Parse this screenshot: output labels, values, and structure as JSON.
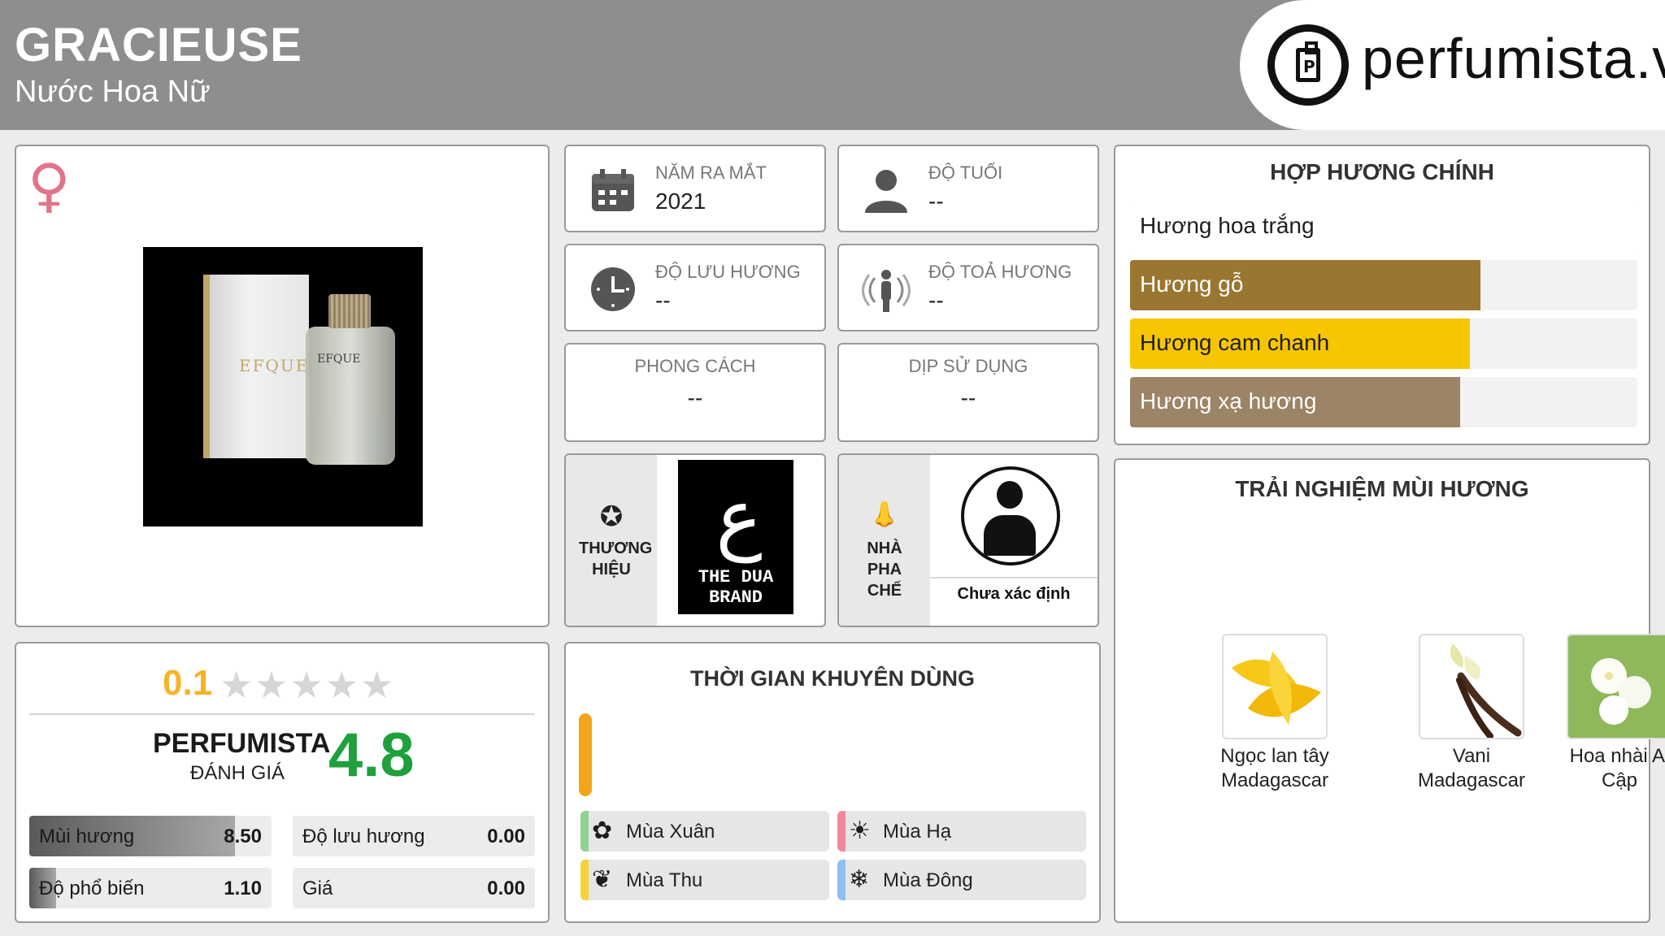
{
  "header": {
    "title": "GRACIEUSE",
    "subtitle": "Nước Hoa Nữ",
    "site": "perfumista.vn"
  },
  "gender_icon": "female-icon",
  "stats": {
    "year": {
      "label": "NĂM RA MẮT",
      "value": "2021"
    },
    "age": {
      "label": "ĐỘ TUỔI",
      "value": "--"
    },
    "longevity": {
      "label": "ĐỘ LƯU HƯƠNG",
      "value": "--"
    },
    "sillage": {
      "label": "ĐỘ TOẢ HƯƠNG",
      "value": "--"
    },
    "style": {
      "label": "PHONG CÁCH",
      "value": "--"
    },
    "occasion": {
      "label": "DỊP SỬ DỤNG",
      "value": "--"
    }
  },
  "brand": {
    "label": "THƯƠNG HIỆU",
    "logo_text": "THE DUA BRAND"
  },
  "perfumer": {
    "label": "NHÀ PHA CHẾ",
    "name": "Chưa xác định"
  },
  "accords": {
    "title": "HỢP HƯƠNG CHÍNH",
    "items": [
      {
        "name": "Hương hoa trắng",
        "fraction": 1.0,
        "color": "#ffffff",
        "text_color": "#1e1e1e"
      },
      {
        "name": "Hương gỗ",
        "fraction": 0.69,
        "color": "#9a7630",
        "text_color": "#ffffff"
      },
      {
        "name": "Hương cam chanh",
        "fraction": 0.67,
        "color": "#f7c600",
        "text_color": "#1e1e1e"
      },
      {
        "name": "Hương xạ hương",
        "fraction": 0.65,
        "color": "#9c8466",
        "text_color": "#ffffff"
      }
    ]
  },
  "notes": {
    "title": "TRẢI NGHIỆM MÙI HƯƠNG",
    "items": [
      {
        "name_line1": "Ngọc lan tây",
        "name_line2": "Madagascar"
      },
      {
        "name_line1": "Vani",
        "name_line2": "Madagascar"
      },
      {
        "name_line1": "Hoa nhài Ai",
        "name_line2": "Cập"
      }
    ]
  },
  "rating": {
    "user_score": "0.1",
    "stars_total": 5,
    "perfumista_label": "PERFUMISTA",
    "perfumista_sub": "ĐÁNH GIÁ",
    "perfumista_score": "4.8",
    "metrics": [
      {
        "label": "Mùi hương",
        "value": "8.50",
        "fraction": 0.85
      },
      {
        "label": "Độ lưu hương",
        "value": "0.00",
        "fraction": 0
      },
      {
        "label": "Độ phổ biến",
        "value": "1.10",
        "fraction": 0.11
      },
      {
        "label": "Giá",
        "value": "0.00",
        "fraction": 0
      }
    ]
  },
  "timing": {
    "title": "THỜI GIAN KHUYÊN DÙNG",
    "seasons": [
      {
        "name": "Mùa Xuân",
        "icon": "flower-icon",
        "color": "#8fd18f"
      },
      {
        "name": "Mùa Hạ",
        "icon": "sun-icon",
        "color": "#f08a9a"
      },
      {
        "name": "Mùa Thu",
        "icon": "leaf-icon",
        "color": "#f5d33a"
      },
      {
        "name": "Mùa Đông",
        "icon": "snowflake-icon",
        "color": "#8fbfef"
      }
    ]
  }
}
